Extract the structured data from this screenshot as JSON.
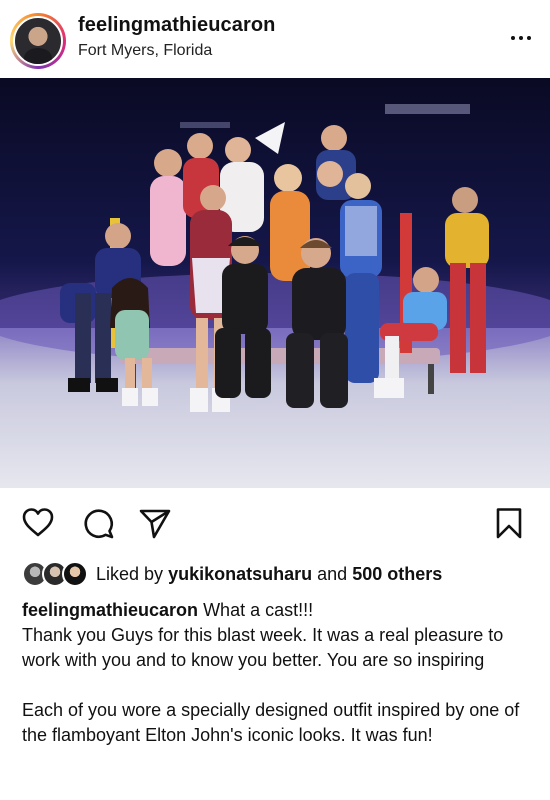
{
  "post": {
    "username": "feelingmathieucaron",
    "location": "Fort Myers, Florida"
  },
  "icons": {
    "like": "heart-icon",
    "comment": "comment-bubble-icon",
    "share": "paper-plane-icon",
    "save": "bookmark-icon",
    "more": "more-dots-icon"
  },
  "likes": {
    "prefix": "Liked by",
    "user": "yukikonatsuharu",
    "and": "and",
    "others": "500 others"
  },
  "caption": {
    "username": "feelingmathieucaron",
    "line1": "What a cast!!!",
    "para1": "Thank you Guys for this blast week. It was a real pleasure to work with you and to know you better. You are so inspiring",
    "para2": "Each of you wore a specially designed outfit inspired by one of the flamboyant Elton John's iconic looks. It was fun!"
  },
  "colors": {
    "text": "#111111",
    "stage_dark": "#0b0d2e",
    "ice": "#d9dbe8",
    "story_ring": [
      "#f58529",
      "#dd2a7b",
      "#8134af"
    ]
  }
}
